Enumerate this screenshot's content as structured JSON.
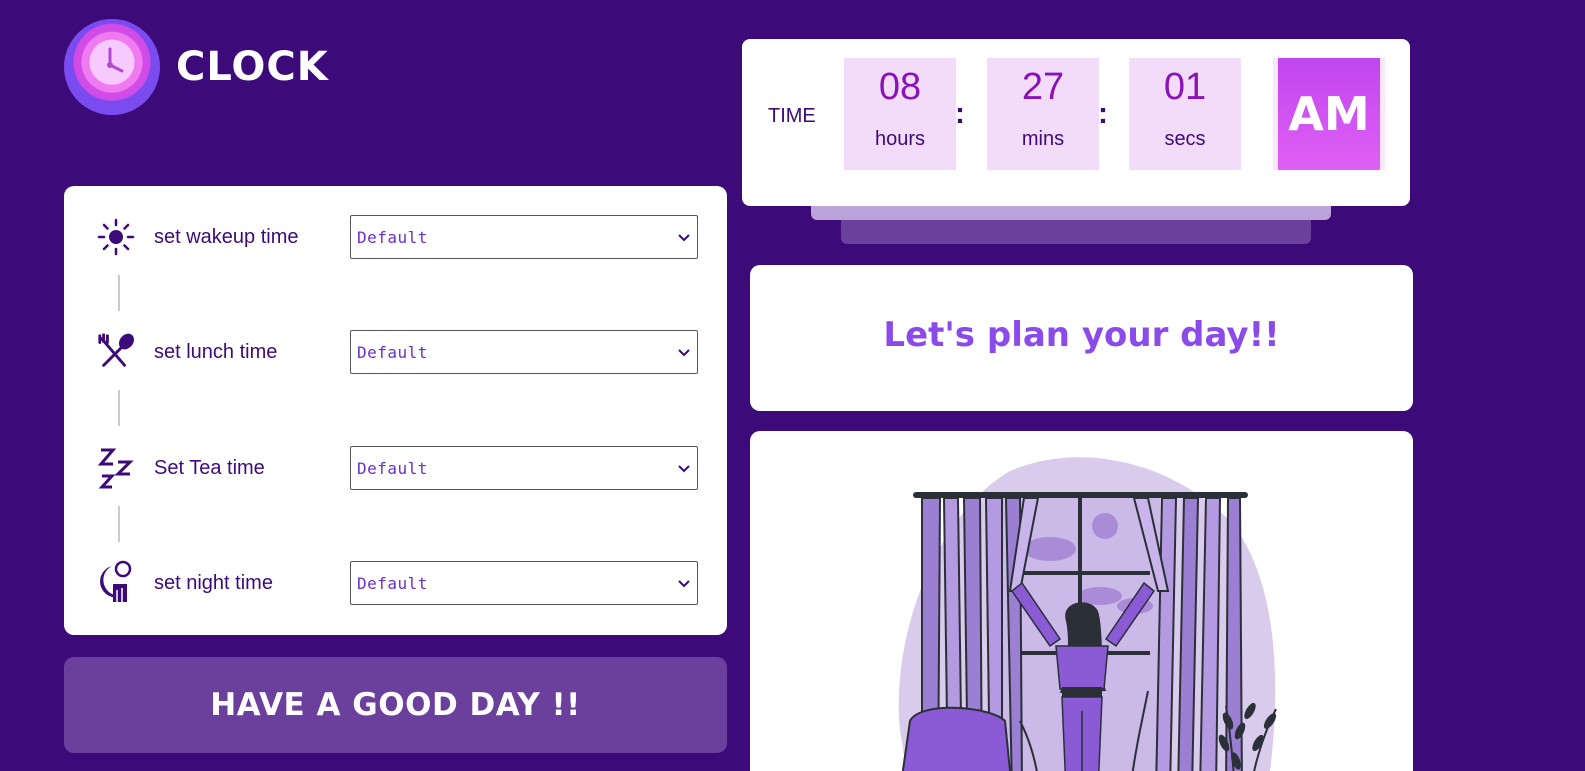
{
  "app": {
    "title": "CLOCK"
  },
  "alarms": [
    {
      "label": "set wakeup time",
      "value": "Default",
      "icon": "sun-icon"
    },
    {
      "label": "set lunch time",
      "value": "Default",
      "icon": "fork-spoon-icon"
    },
    {
      "label": "Set Tea time",
      "value": "Default",
      "icon": "zzz-icon"
    },
    {
      "label": "set night time",
      "value": "Default",
      "icon": "moon-icon"
    }
  ],
  "banner": {
    "text": "HAVE A GOOD DAY !!"
  },
  "clock": {
    "label": "TIME",
    "hours": "08",
    "hours_unit": "hours",
    "mins": "27",
    "mins_unit": "mins",
    "secs": "01",
    "secs_unit": "secs",
    "separator": ":",
    "period": "AM"
  },
  "plan": {
    "text": "Let's plan your day!!"
  },
  "colors": {
    "background": "#3d0a7a",
    "accent": "#8b4bea",
    "digit": "#8a12b8",
    "ampm": "#d052f2"
  }
}
